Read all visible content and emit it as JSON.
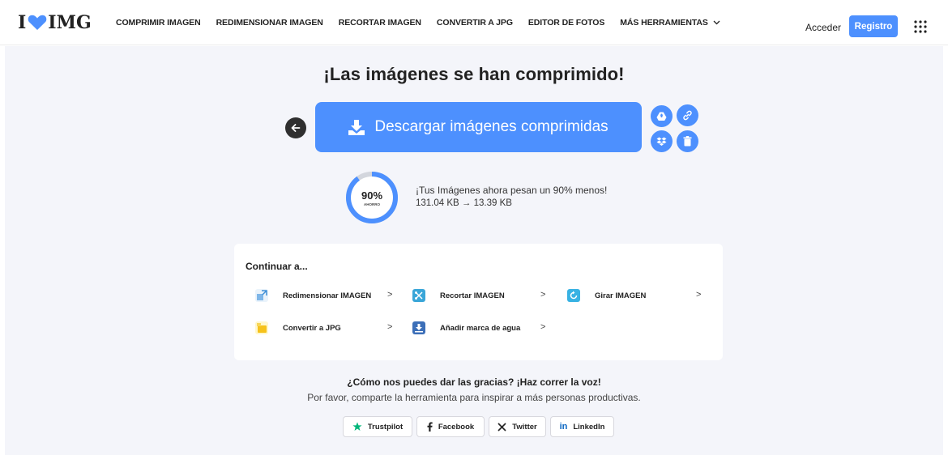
{
  "header": {
    "logo_left": "I",
    "logo_right": "IMG",
    "nav": [
      "COMPRIMIR IMAGEN",
      "REDIMENSIONAR IMAGEN",
      "RECORTAR IMAGEN",
      "CONVERTIR A JPG",
      "EDITOR DE FOTOS",
      "MÁS HERRAMIENTAS"
    ],
    "login": "Acceder",
    "register": "Registro"
  },
  "main": {
    "title": "¡Las imágenes se han comprimido!",
    "download_label": "Descargar imágenes comprimidas",
    "savings": {
      "percent": "90%",
      "percent_label": "AHORRO",
      "percent_value": 90,
      "message": "¡Tus Imágenes ahora pesan un 90% menos!",
      "sizes": "131.04 KB → 13.39 KB"
    },
    "continue": {
      "title": "Continuar a...",
      "items": [
        "Redimensionar IMAGEN",
        "Recortar IMAGEN",
        "Girar IMAGEN",
        "Convertir a JPG",
        "Añadir marca de agua"
      ]
    },
    "thanks": {
      "heading": "¿Cómo nos puedes dar las gracias? ¡Haz correr la voz!",
      "subtitle": "Por favor, comparte la herramienta para inspirar a más personas productivas."
    },
    "share": [
      "Trustpilot",
      "Facebook",
      "Twitter",
      "LinkedIn"
    ]
  },
  "colors": {
    "accent": "#4d90fe",
    "logo_heart": "#4d90fe",
    "trustpilot": "#00b67a",
    "linkedin": "#0a66c2"
  }
}
